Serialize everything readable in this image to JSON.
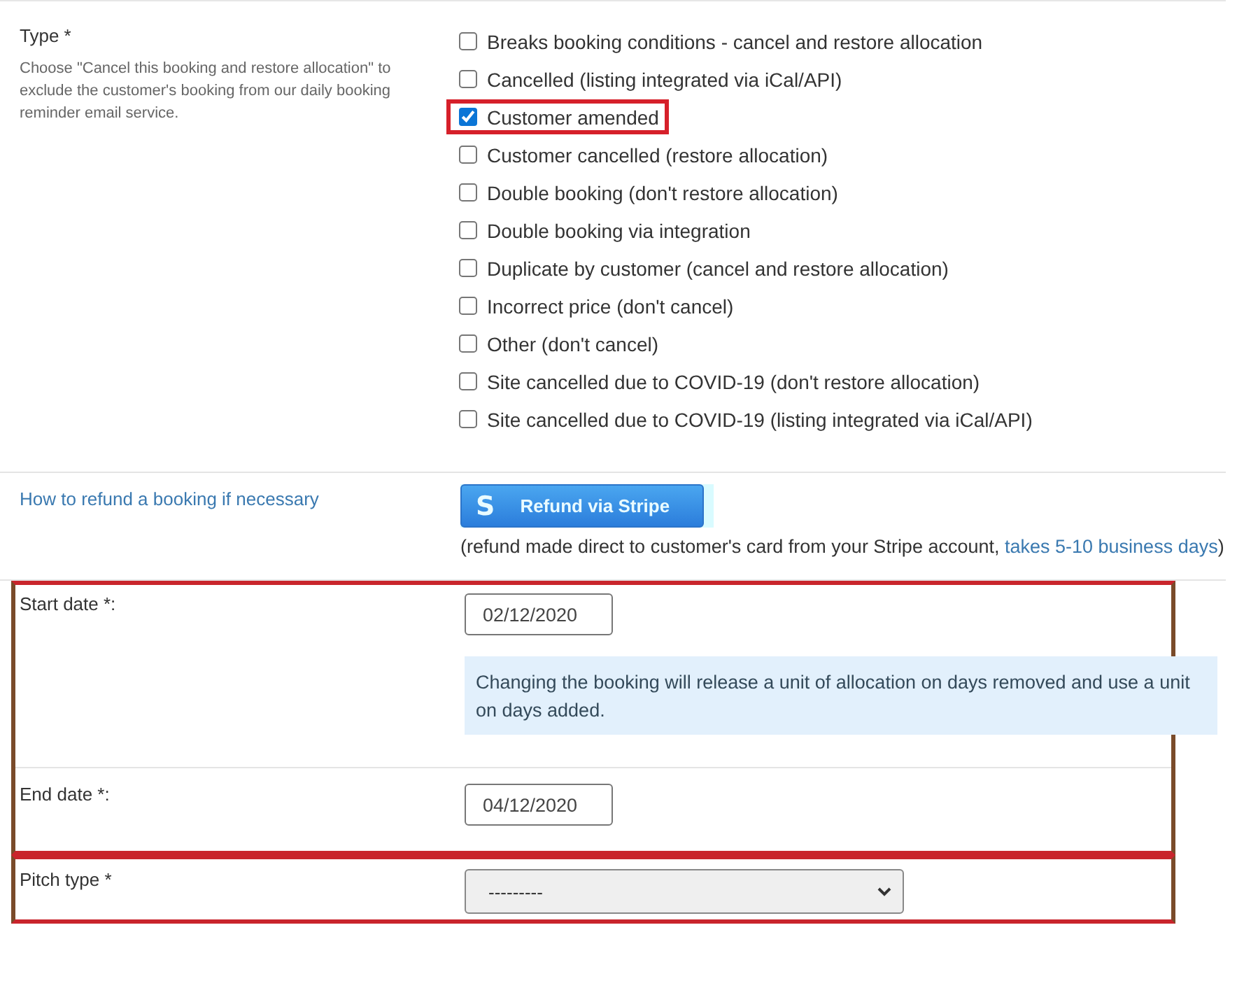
{
  "type_section": {
    "label": "Type *",
    "help": "Choose \"Cancel this booking and restore allocation\" to exclude the customer's booking from our daily booking reminder email service.",
    "options": [
      {
        "label": "Breaks booking conditions - cancel and restore allocation",
        "checked": false,
        "highlighted": false
      },
      {
        "label": "Cancelled (listing integrated via iCal/API)",
        "checked": false,
        "highlighted": false
      },
      {
        "label": "Customer amended",
        "checked": true,
        "highlighted": true
      },
      {
        "label": "Customer cancelled (restore allocation)",
        "checked": false,
        "highlighted": false
      },
      {
        "label": "Double booking (don't restore allocation)",
        "checked": false,
        "highlighted": false
      },
      {
        "label": "Double booking via integration",
        "checked": false,
        "highlighted": false
      },
      {
        "label": "Duplicate by customer (cancel and restore allocation)",
        "checked": false,
        "highlighted": false
      },
      {
        "label": "Incorrect price (don't cancel)",
        "checked": false,
        "highlighted": false
      },
      {
        "label": "Other (don't cancel)",
        "checked": false,
        "highlighted": false
      },
      {
        "label": "Site cancelled due to COVID-19 (don't restore allocation)",
        "checked": false,
        "highlighted": false
      },
      {
        "label": "Site cancelled due to COVID-19 (listing integrated via iCal/API)",
        "checked": false,
        "highlighted": false
      }
    ]
  },
  "refund_section": {
    "link": "How to refund a booking if necessary",
    "button": {
      "icon_letter": "S",
      "label": "Refund via Stripe"
    },
    "note": "(refund made direct to customer's card from your Stripe account, ",
    "note_link": "takes 5-10 business days",
    "note_end": ")"
  },
  "date_group": {
    "highlighted": true,
    "start": {
      "label": "Start date *:",
      "value": "02/12/2020",
      "info": "Changing the booking will release a unit of allocation on days removed and use a unit on days added."
    },
    "end": {
      "label": "End date *:",
      "value": "04/12/2020"
    }
  },
  "pitch": {
    "label": "Pitch type *",
    "value": "---------",
    "highlighted": true
  }
}
